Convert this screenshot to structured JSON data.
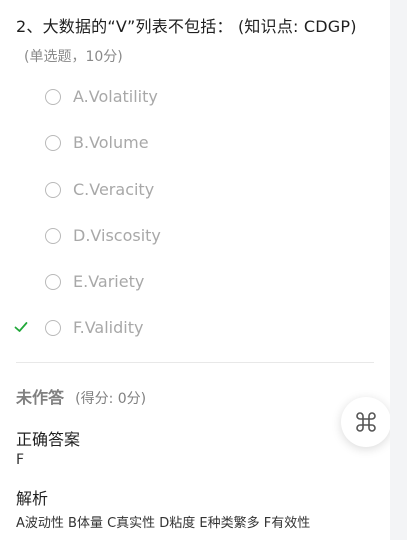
{
  "question": {
    "title": "2、大数据的“V”列表不包括：  (知识点: CDGP)",
    "meta": "(单选题，10分)"
  },
  "options": [
    {
      "label": "A.Volatility",
      "correct": false
    },
    {
      "label": "B.Volume",
      "correct": false
    },
    {
      "label": "C.Veracity",
      "correct": false
    },
    {
      "label": "D.Viscosity",
      "correct": false
    },
    {
      "label": "E.Variety",
      "correct": false
    },
    {
      "label": "F.Validity",
      "correct": true
    }
  ],
  "result": {
    "status": "未作答",
    "score": "(得分: 0分)"
  },
  "answer": {
    "title": "正确答案",
    "value": "F"
  },
  "analysis": {
    "title": "解析",
    "text": "A波动性 B体量 C真实性 D粘度 E种类繁多 F有效性"
  },
  "icons": {
    "check": "check-icon",
    "floating": "command-icon"
  },
  "colors": {
    "check": "#22a83a",
    "option_text": "#a8a8a8",
    "status_text": "#808080"
  }
}
